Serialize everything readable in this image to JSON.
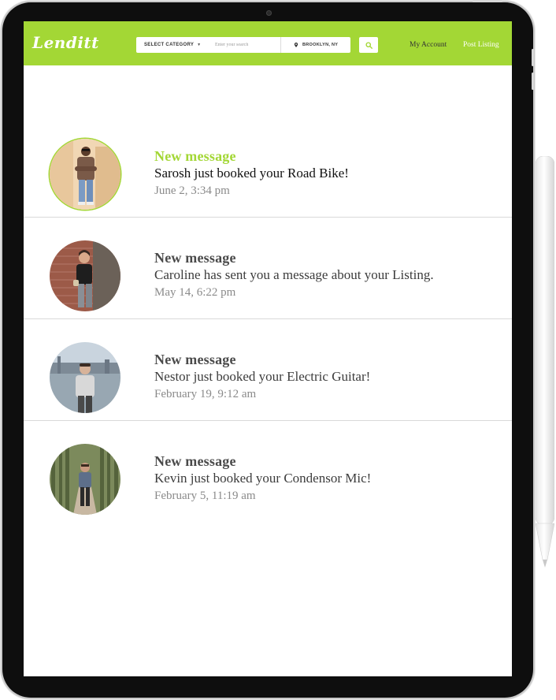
{
  "app": {
    "logo": "Lenditt"
  },
  "header": {
    "category_label": "SELECT CATEGORY",
    "search_placeholder": "Enter your search",
    "location": "BROOKLYN, NY",
    "my_account": "My Account",
    "post_listing": "Post Listing"
  },
  "colors": {
    "brand": "#a3d735",
    "text_dark": "#3c3c3c",
    "text_muted": "#8a8a8a"
  },
  "notifications": [
    {
      "title": "New message",
      "body": "Sarosh just booked your Road Bike!",
      "time": "June 2,  3:34 pm",
      "unread": true
    },
    {
      "title": "New message",
      "body": "Caroline has sent you a message about your Listing.",
      "time": "May 14,  6:22 pm",
      "unread": false
    },
    {
      "title": "New message",
      "body": "Nestor just booked your Electric Guitar!",
      "time": "February 19,  9:12 am",
      "unread": false
    },
    {
      "title": "New message",
      "body": "Kevin just booked your Condensor Mic!",
      "time": "February 5,  11:19 am",
      "unread": false
    }
  ]
}
